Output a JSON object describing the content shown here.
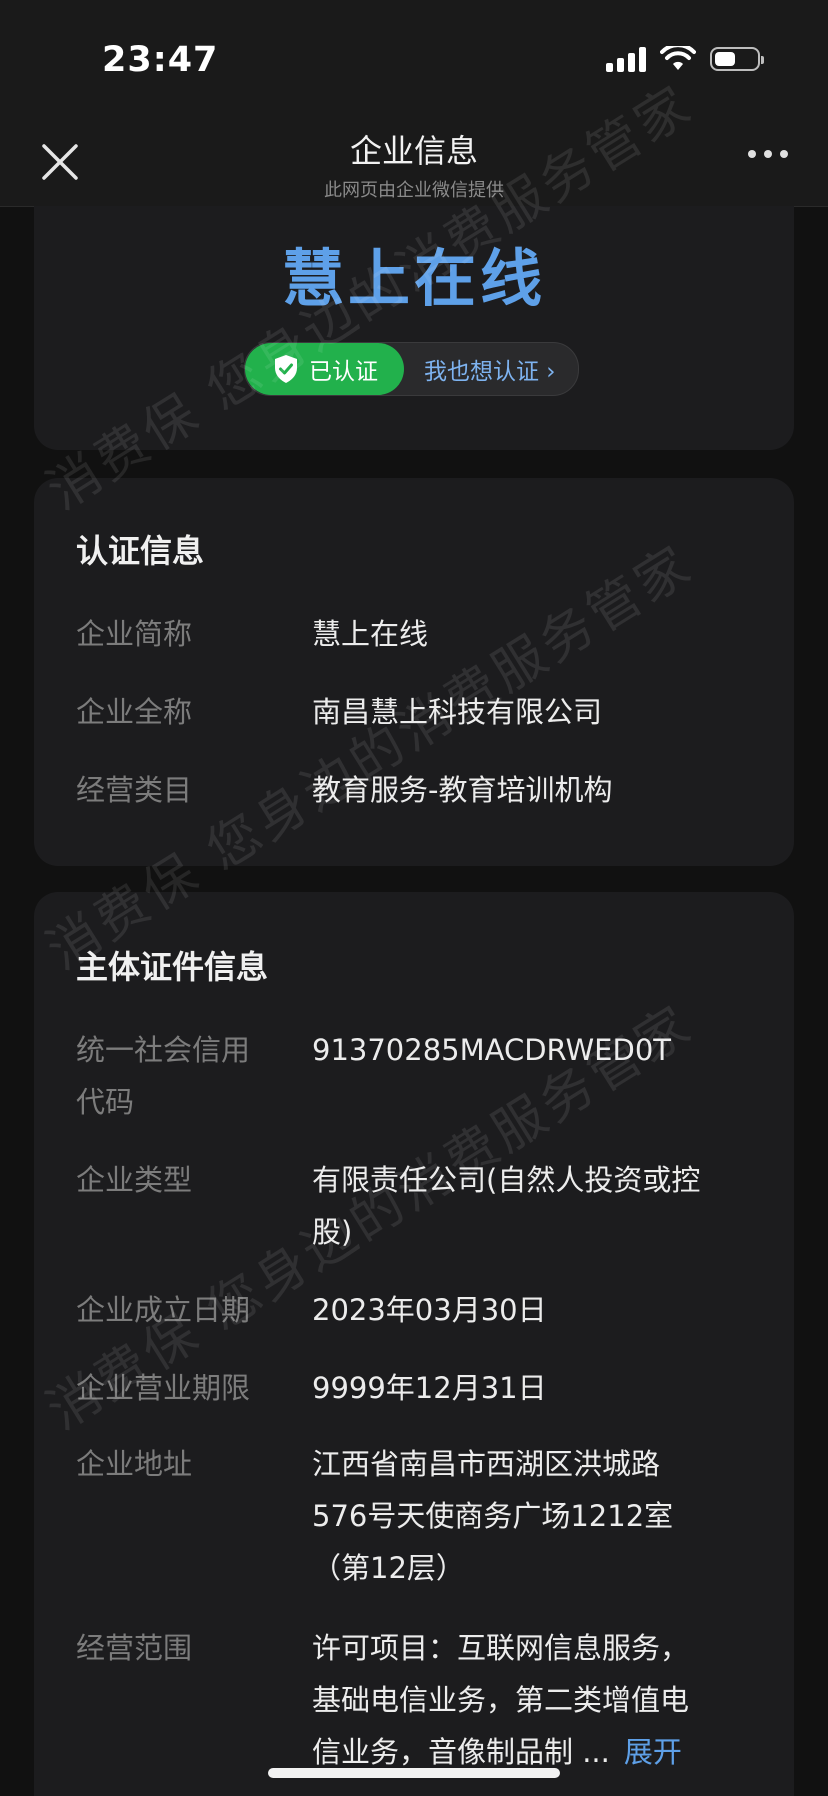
{
  "status_bar": {
    "time": "23:47",
    "battery_level": 0.5
  },
  "nav": {
    "title": "企业信息",
    "subtitle": "此网页由企业微信提供",
    "close_icon": "close-icon",
    "more_icon": "more-icon"
  },
  "header": {
    "brand_name": "慧上在线",
    "verified_label": "已认证",
    "want_verify_label": "我也想认证 ›"
  },
  "certification": {
    "title": "认证信息",
    "rows": [
      {
        "label": "企业简称",
        "value": "慧上在线"
      },
      {
        "label": "企业全称",
        "value": "南昌慧上科技有限公司"
      },
      {
        "label": "经营类目",
        "value": "教育服务-教育培训机构"
      }
    ]
  },
  "entity": {
    "title": "主体证件信息",
    "rows": [
      {
        "label_lines": [
          "统一社会信用",
          "代码"
        ],
        "value_lines": [
          "91370285MACDRWED0T"
        ]
      },
      {
        "label_lines": [
          "企业类型"
        ],
        "value_lines": [
          "有限责任公司(自然人投资或控",
          "股)"
        ]
      },
      {
        "label_lines": [
          "企业成立日期"
        ],
        "value_lines": [
          "2023年03月30日"
        ]
      },
      {
        "label_lines": [
          "企业营业期限"
        ],
        "value_lines": [
          "9999年12月31日"
        ]
      },
      {
        "label_lines": [
          "企业地址"
        ],
        "value_lines": [
          "江西省南昌市西湖区洪城路",
          "576号天使商务广场1212室",
          "（第12层）"
        ]
      },
      {
        "label_lines": [
          "经营范围"
        ],
        "value_lines": [
          "许可项目：互联网信息服务，",
          "基础电信业务，第二类增值电",
          "信业务，音像制品制  ..."
        ]
      }
    ],
    "expand_label": "展开"
  },
  "watermark": {
    "text": "消费保 您身边的消费服务管家"
  },
  "colors": {
    "accent_blue": "#5ea0e8",
    "verified_green": "#22b14c",
    "background": "#111111",
    "card": "#1c1c1e"
  }
}
